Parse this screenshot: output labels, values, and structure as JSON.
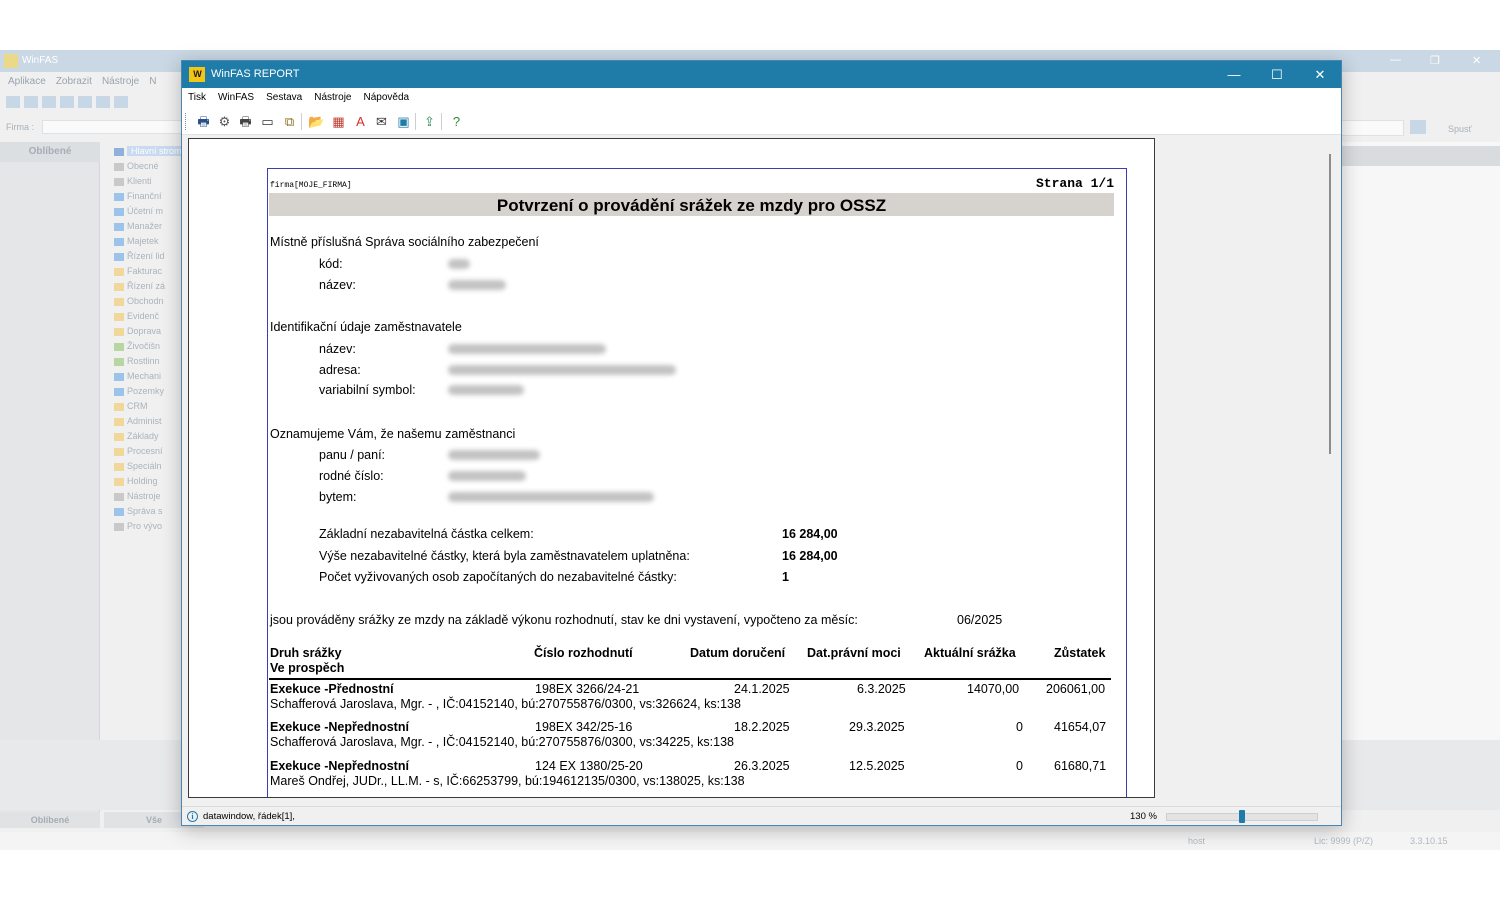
{
  "background_app": {
    "title": "WinFAS",
    "menu": [
      "Aplikace",
      "Zobrazit",
      "Nástroje",
      "N"
    ],
    "firma_label": "Firma :",
    "favorites_tab": "Oblíbené",
    "tree": [
      {
        "label": "Hlavní strom",
        "color": "#8fb0dd",
        "selected": true
      },
      {
        "label": "Obecné",
        "color": "#c9c9c9"
      },
      {
        "label": "Klienti",
        "color": "#c9c9c9"
      },
      {
        "label": "Finanční",
        "color": "#9cc3ea"
      },
      {
        "label": "Účetní m",
        "color": "#9cc3ea"
      },
      {
        "label": "Manažer",
        "color": "#9cc3ea"
      },
      {
        "label": "Majetek",
        "color": "#9cc3ea"
      },
      {
        "label": "Řízení lid",
        "color": "#9cc3ea"
      },
      {
        "label": "Fakturac",
        "color": "#f2d79a"
      },
      {
        "label": "Řízení zá",
        "color": "#f2d79a"
      },
      {
        "label": "Obchodn",
        "color": "#f2d79a"
      },
      {
        "label": "Evidenč",
        "color": "#f2d79a"
      },
      {
        "label": "Doprava",
        "color": "#f2d79a"
      },
      {
        "label": "Živočišn",
        "color": "#b8d6a0"
      },
      {
        "label": "Rostlinn",
        "color": "#b8d6a0"
      },
      {
        "label": "Mechani",
        "color": "#9cc3ea"
      },
      {
        "label": "Pozemky",
        "color": "#9cc3ea"
      },
      {
        "label": "CRM",
        "color": "#f2d79a"
      },
      {
        "label": "Administ",
        "color": "#f2d79a"
      },
      {
        "label": "Základy",
        "color": "#f2d79a"
      },
      {
        "label": "Procesní",
        "color": "#f2d79a"
      },
      {
        "label": "Speciáln",
        "color": "#f2d79a"
      },
      {
        "label": "Holding",
        "color": "#f2d79a"
      },
      {
        "label": "Nástroje",
        "color": "#c9c9c9"
      },
      {
        "label": "Správa s",
        "color": "#9cc3ea"
      },
      {
        "label": "Pro vývo",
        "color": "#c9c9c9"
      }
    ],
    "bottom_tabs": [
      "Oblíbené",
      "Vše"
    ],
    "spust_label": "Spusť",
    "status": {
      "host": "host",
      "lic": "Lic: 9999 (P/Z)",
      "version": "3.3.10.15"
    }
  },
  "window": {
    "title": "WinFAS REPORT",
    "logo_text": "W",
    "controls": {
      "minimize": "—",
      "maximize": "☐",
      "close": "✕"
    }
  },
  "menu": [
    "Tisk",
    "WinFAS",
    "Sestava",
    "Nástroje",
    "Nápověda"
  ],
  "toolbar_icons": [
    {
      "name": "print-icon",
      "glyph": "🖶",
      "color": "#2a4f8a"
    },
    {
      "name": "print-settings-icon",
      "glyph": "⚙",
      "color": "#555555"
    },
    {
      "name": "printer-icon",
      "glyph": "🖶",
      "color": "#444444"
    },
    {
      "name": "page-setup-icon",
      "glyph": "▭",
      "color": "#333333"
    },
    {
      "name": "copy-pages-icon",
      "glyph": "⧉",
      "color": "#8a6a1a"
    },
    {
      "name": "export-folder-icon",
      "glyph": "📂",
      "color": "#c9961a"
    },
    {
      "name": "excel-export-icon",
      "glyph": "▦",
      "color": "#c0392b"
    },
    {
      "name": "pdf-export-icon",
      "glyph": "A",
      "color": "#d62e2e"
    },
    {
      "name": "email-icon",
      "glyph": "✉",
      "color": "#333333"
    },
    {
      "name": "save-icon",
      "glyph": "▣",
      "color": "#1f7ca8"
    },
    {
      "name": "upload-icon",
      "glyph": "⇪",
      "color": "#2e8b57"
    },
    {
      "name": "help-icon",
      "glyph": "?",
      "color": "#2e8b2e"
    }
  ],
  "report": {
    "firma": "firma[MOJE_FIRMA]",
    "strana": "Strana 1/1",
    "title": "Potvrzení o provádění srážek ze mzdy pro OSSZ",
    "section1": {
      "heading": "Místně příslušná Správa sociálního zabezpečení",
      "labels": {
        "kod": "kód:",
        "nazev": "název:"
      }
    },
    "section2": {
      "heading": "Identifikační údaje zaměstnavatele",
      "labels": {
        "nazev": "název:",
        "adresa": "adresa:",
        "vs": "variabilní symbol:"
      }
    },
    "section3": {
      "heading": "Oznamujeme Vám, že našemu zaměstnanci",
      "labels": {
        "panu": "panu / paní:",
        "rc": "rodné číslo:",
        "bytem": "bytem:"
      }
    },
    "amounts": [
      {
        "label": "Základní nezabavitelná částka celkem:",
        "value": "16 284,00"
      },
      {
        "label": "Výše nezabavitelné částky, která byla zaměstnavatelem uplatněna:",
        "value": "16 284,00"
      },
      {
        "label": "Počet vyživovaných osob započítaných do nezabavitelné částky:",
        "value": "1"
      }
    ],
    "statement": "jsou prováděny srážky ze mzdy na základě výkonu rozhodnutí, stav ke dni vystavení, vypočteno za měsíc:",
    "month": "06/2025",
    "table": {
      "headers": {
        "druh": "Druh srážky",
        "ve_prospech": "Ve prospěch",
        "cislo": "Číslo rozhodnutí",
        "datum": "Datum doručení",
        "pravni": "Dat.právní moci",
        "aktualni": "Aktuální srážka",
        "zustatek": "Zůstatek"
      },
      "rows": [
        {
          "druh": "Exekuce -Přednostní",
          "cislo": "198EX 3266/24-21",
          "datum": "24.1.2025",
          "pravni": "6.3.2025",
          "aktualni": "14070,00",
          "zustatek": "206061,00",
          "prospech": "Schafferová Jaroslava, Mgr. - , IČ:04152140, bú:270755876/0300, vs:326624, ks:138"
        },
        {
          "druh": "Exekuce -Nepřednostní",
          "cislo": "198EX 342/25-16",
          "datum": "18.2.2025",
          "pravni": "29.3.2025",
          "aktualni": "0",
          "zustatek": "41654,07",
          "prospech": "Schafferová Jaroslava, Mgr. - , IČ:04152140, bú:270755876/0300, vs:34225, ks:138"
        },
        {
          "druh": "Exekuce -Nepřednostní",
          "cislo": "124 EX 1380/25-20",
          "datum": "26.3.2025",
          "pravni": "12.5.2025",
          "aktualni": "0",
          "zustatek": "61680,71",
          "prospech": "Mareš Ondřej, JUDr., LL.M. - s, IČ:66253799, bú:194612135/0300, vs:138025, ks:138"
        }
      ]
    }
  },
  "statusbar": {
    "info_icon": "i",
    "text": "datawindow, řádek[1],",
    "zoom": "130 %",
    "zoom_level_percent": 50
  }
}
